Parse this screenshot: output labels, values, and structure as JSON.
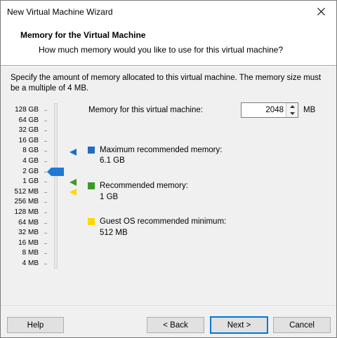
{
  "window": {
    "title": "New Virtual Machine Wizard"
  },
  "header": {
    "title": "Memory for the Virtual Machine",
    "subtitle": "How much memory would you like to use for this virtual machine?"
  },
  "description": "Specify the amount of memory allocated to this virtual machine. The memory size must be a multiple of 4 MB.",
  "scale_labels": [
    "128 GB",
    "64 GB",
    "32 GB",
    "16 GB",
    "8 GB",
    "4 GB",
    "2 GB",
    "1 GB",
    "512 MB",
    "256 MB",
    "128 MB",
    "64 MB",
    "32 MB",
    "16 MB",
    "8 MB",
    "4 MB"
  ],
  "memory": {
    "label": "Memory for this virtual machine:",
    "value": "2048",
    "unit": "MB"
  },
  "legend": {
    "max_label": "Maximum recommended memory:",
    "max_value": "6.1 GB",
    "rec_label": "Recommended memory:",
    "rec_value": "1 GB",
    "min_label": "Guest OS recommended minimum:",
    "min_value": "512 MB"
  },
  "colors": {
    "max": "#1e6fbf",
    "rec": "#3a9a26",
    "min": "#ffd800",
    "thumb": "#1f7ad6"
  },
  "buttons": {
    "help": "Help",
    "back": "< Back",
    "next": "Next >",
    "cancel": "Cancel"
  }
}
